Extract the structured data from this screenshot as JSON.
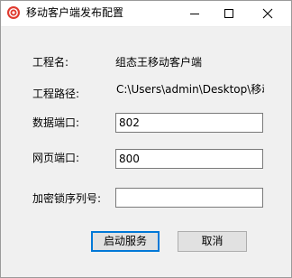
{
  "window": {
    "title": "移动客户端发布配置"
  },
  "icons": {
    "app": "app-logo-icon",
    "minimize": "minimize-icon",
    "maximize": "maximize-icon",
    "close": "close-icon"
  },
  "form": {
    "project_name_label": "工程名:",
    "project_name_value": "组态王移动客户端",
    "project_path_label": "工程路径:",
    "project_path_value": "C:\\Users\\admin\\Desktop\\移动客户端",
    "data_port_label": "数据端口:",
    "data_port_value": "802",
    "web_port_label": "网页端口:",
    "web_port_value": "800",
    "lock_serial_label": "加密锁序列号:",
    "lock_serial_value": ""
  },
  "buttons": {
    "start_service": "启动服务",
    "cancel": "取消"
  },
  "colors": {
    "window_bg": "#f0f0f0",
    "titlebar_bg": "#ffffff",
    "default_button_border": "#0078d7",
    "icon_red": "#e03a2f"
  }
}
